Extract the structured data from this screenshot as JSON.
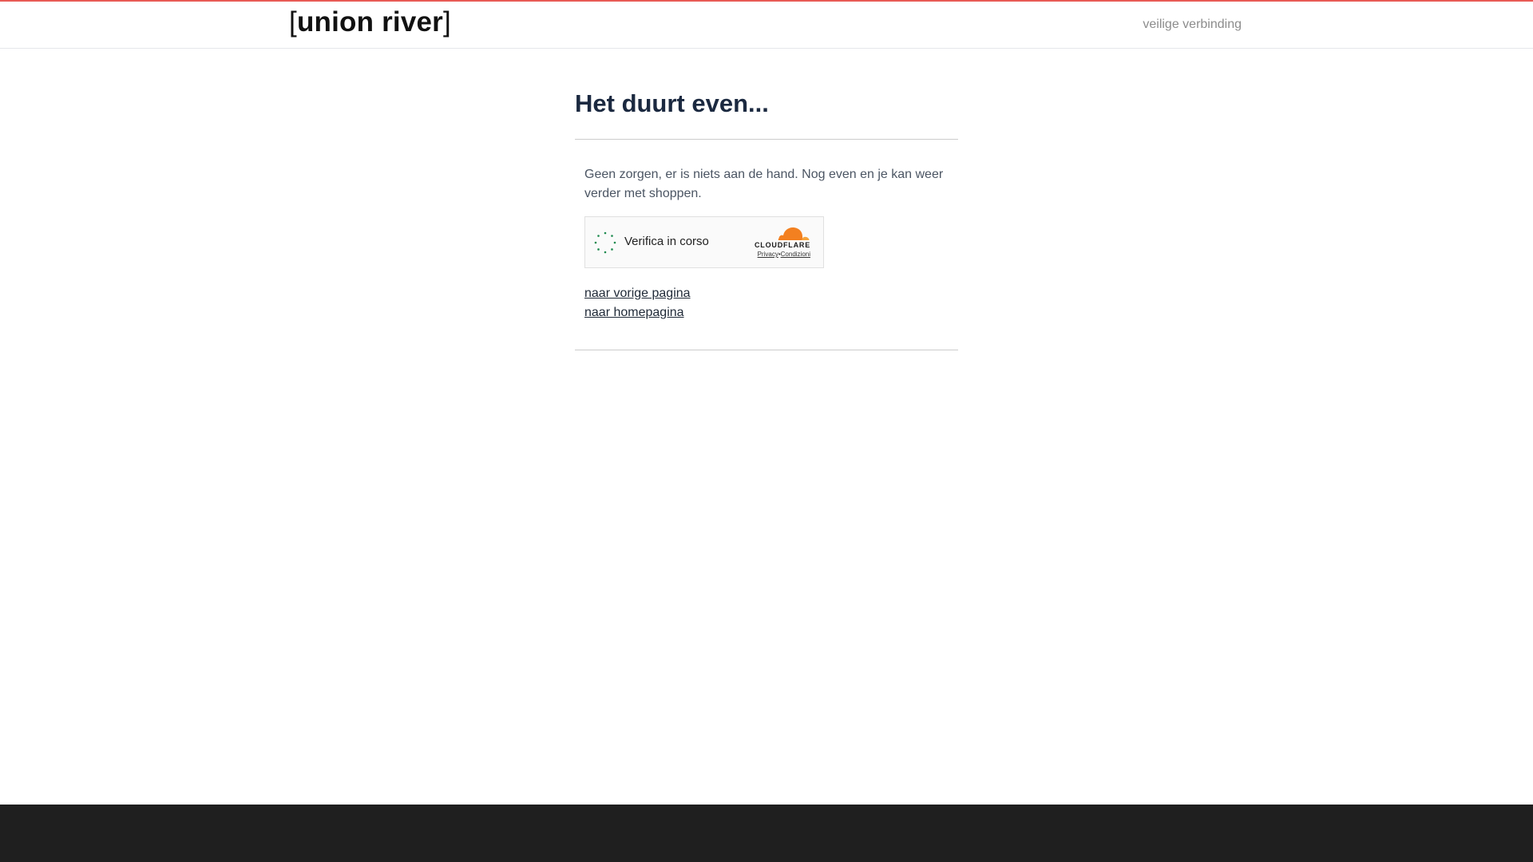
{
  "colors": {
    "accent": "#e85a55",
    "title": "#1b2940",
    "footer": "#1f1f1f",
    "spinner": "#1d8a4e",
    "cloudflare_orange": "#f38020"
  },
  "header": {
    "logo_open_bracket": "[",
    "logo_text": "union river",
    "logo_close_bracket": "]",
    "secure_label": "veilige verbinding"
  },
  "main": {
    "title": "Het duurt even...",
    "message": "Geen zorgen, er is niets aan de hand. Nog even en je kan weer verder met shoppen.",
    "turnstile": {
      "status_text": "Verifica in corso",
      "spinner_icon": "loading-spinner-icon",
      "brand_icon": "cloudflare-cloud-icon",
      "brand_name": "CLOUDFLARE",
      "privacy_label": "Privacy",
      "separator": "•",
      "terms_label": "Condizioni"
    },
    "links": {
      "previous_page": "naar vorige pagina",
      "homepage": "naar homepagina"
    }
  }
}
